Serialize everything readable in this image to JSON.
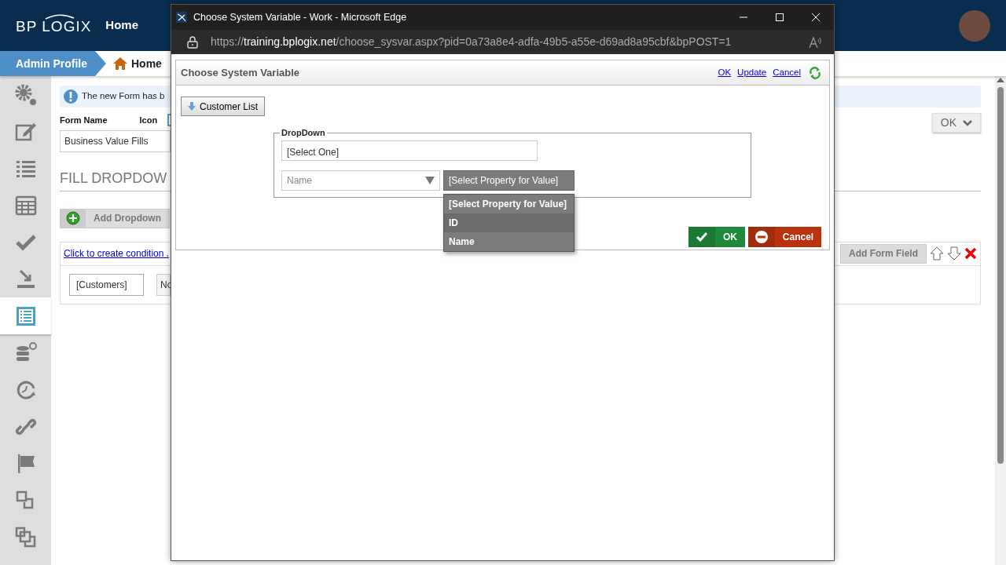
{
  "app": {
    "logo": "BP LOGIX",
    "nav": [
      {
        "label": "Home",
        "selected": true
      }
    ],
    "breadcrumb": [
      {
        "label": "Admin Profile",
        "kind": "profile"
      },
      {
        "label": "Home",
        "kind": "home"
      }
    ],
    "sidebar": [
      {
        "kind": "gear",
        "selected": false
      },
      {
        "kind": "edit",
        "selected": false
      },
      {
        "kind": "list",
        "selected": false
      },
      {
        "kind": "table",
        "selected": false
      },
      {
        "kind": "check",
        "selected": false
      },
      {
        "kind": "download",
        "selected": false
      },
      {
        "kind": "form",
        "selected": true
      },
      {
        "kind": "database",
        "selected": false
      },
      {
        "kind": "clock",
        "selected": false
      },
      {
        "kind": "link",
        "selected": false
      },
      {
        "kind": "flag",
        "selected": false
      },
      {
        "kind": "copy",
        "selected": false
      },
      {
        "kind": "copy2",
        "selected": false
      }
    ],
    "notice": "The new Form has b",
    "form_name_label": "Form Name",
    "icon_label": "Icon",
    "form_name_value": "Business Value Fills",
    "ok_menu": "OK",
    "heading": "FILL DROPDOW",
    "add_dropdown": "Add Dropdown",
    "condition_link": "Click to create condition .",
    "add_form_field": "Add Form Field",
    "row": {
      "source": "[Customers]",
      "field": "No"
    }
  },
  "browser_window": {
    "title": "Choose System Variable - Work - Microsoft Edge",
    "url_scheme": "https://",
    "url_host": "training.bplogix.net",
    "url_path": "/choose_sysvar.aspx?pid=0a73a8e4-adfa-49b5-a55e-d69ad8a95cbf&bpPOST=1"
  },
  "dialog": {
    "title": "Choose System Variable",
    "header_links": [
      "OK",
      "Update",
      "Cancel"
    ],
    "crumb_button": "Customer List",
    "legend": "DropDown",
    "value_field": "[Select One]",
    "name_select": "Name",
    "property_select": {
      "value": "[Select Property for Value]",
      "expanded": true,
      "options": [
        {
          "label": "[Select Property for Value]",
          "highlighted": false
        },
        {
          "label": "ID",
          "highlighted": true
        },
        {
          "label": "Name",
          "highlighted": false
        }
      ]
    },
    "buttons": [
      {
        "label": "OK",
        "kind": "ok"
      },
      {
        "label": "Cancel",
        "kind": "cancel"
      }
    ]
  }
}
